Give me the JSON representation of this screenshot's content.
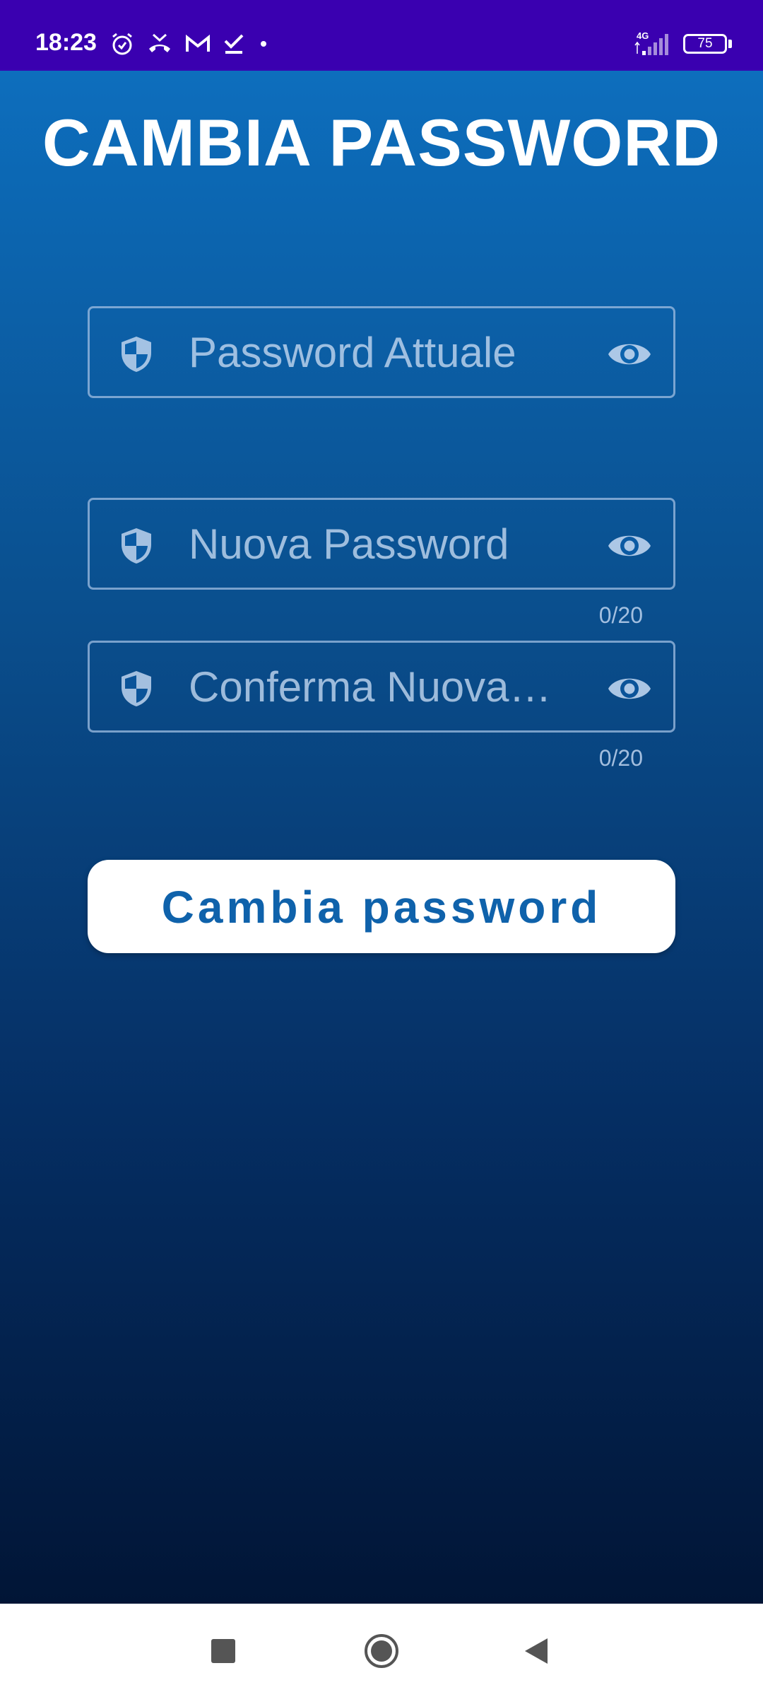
{
  "status_bar": {
    "time": "18:23",
    "network": "4G",
    "battery_level": "75",
    "left_icons": [
      "alarm-icon",
      "missed-call-icon",
      "gmail-icon",
      "task-check-icon",
      "notification-dot-icon"
    ],
    "right_icons": [
      "signal-icon",
      "battery-icon"
    ]
  },
  "page": {
    "title": "CAMBIA PASSWORD"
  },
  "form": {
    "current_password": {
      "placeholder": "Password Attuale",
      "value": "",
      "leading_icon": "shield-icon",
      "trailing_icon": "eye-icon"
    },
    "new_password": {
      "placeholder": "Nuova Password",
      "value": "",
      "counter": "0/20",
      "leading_icon": "shield-icon",
      "trailing_icon": "eye-icon"
    },
    "confirm_password": {
      "placeholder": "Conferma Nuova…",
      "value": "",
      "counter": "0/20",
      "leading_icon": "shield-icon",
      "trailing_icon": "eye-icon"
    },
    "submit_label": "Cambia password"
  },
  "nav_bar": {
    "buttons": [
      "recents-icon",
      "home-icon",
      "back-icon"
    ]
  },
  "colors": {
    "status_bar": "#3a00b0",
    "gradient_top": "#0d6ebd",
    "gradient_bottom": "#011536",
    "button_text": "#0f62ab",
    "field_border": "#a0bee1"
  }
}
